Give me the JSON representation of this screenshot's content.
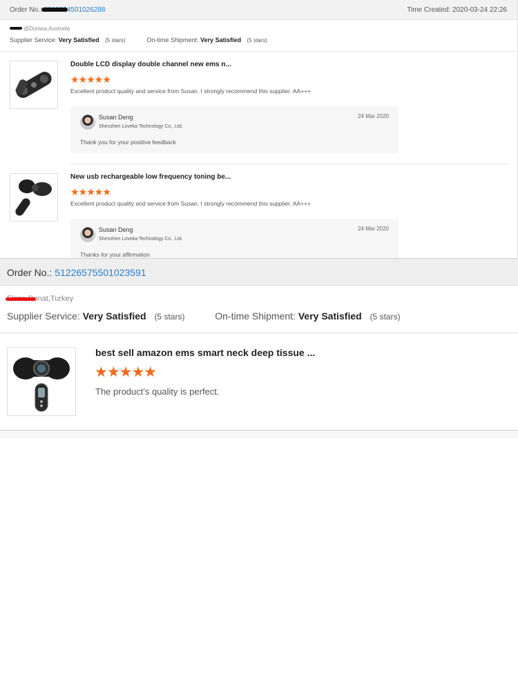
{
  "order1": {
    "order_label": "Order No.:",
    "order_number": "2010684501026288",
    "time_label": "Time Created:",
    "time_value": "2020-03-24 22:26",
    "buyer": "@Durasa,Australia",
    "supplier_label": "Supplier Service:",
    "supplier_value": "Very Satisfied",
    "supplier_stars": "(5 stars)",
    "shipment_label": "On-time Shipment:",
    "shipment_value": "Very Satisfied",
    "shipment_stars": "(5 stars)",
    "items": [
      {
        "title": "Double LCD display double channel new ems n...",
        "rating": 5,
        "stars": "★★★★★",
        "comment": "Excellent product quality and service from Susan. I strongly recommend this supplier. AA+++",
        "reply": {
          "name": "Susan Deng",
          "company": "Shenzhen Loveka Technology Co., Ltd.",
          "date": "24 Mar 2020",
          "text": "Thank you for your positive feedback"
        }
      },
      {
        "title": "New usb rechargeable low frequency toning be...",
        "rating": 5,
        "stars": "★★★★★",
        "comment": "Excellent product quality and service from Susan. I strongly recommend this supplier. AA+++",
        "reply": {
          "name": "Susan Deng",
          "company": "Shenzhen Loveka Technology Co., Ltd.",
          "date": "24 Mar 2020",
          "text": "Thanks for your affirmation"
        }
      }
    ]
  },
  "order2": {
    "order_label": "Order No.:",
    "order_number": "51226575501023591",
    "buyer": "Elcan Donat,Turkey",
    "supplier_label": "Supplier Service:",
    "supplier_value": "Very Satisfied",
    "supplier_stars": "(5 stars)",
    "shipment_label": "On-time Shipment:",
    "shipment_value": "Very Satisfied",
    "shipment_stars": "(5 stars)",
    "item": {
      "title": "best sell amazon ems smart neck deep tissue ...",
      "rating": 5,
      "stars": "★★★★★",
      "comment": "The product's quality is perfect."
    }
  },
  "colors": {
    "link": "#2a7ec8",
    "star": "#f26a1b",
    "header_bg": "#f2f2f2",
    "redaction_black": "#111111",
    "redaction_red": "#e11111"
  }
}
